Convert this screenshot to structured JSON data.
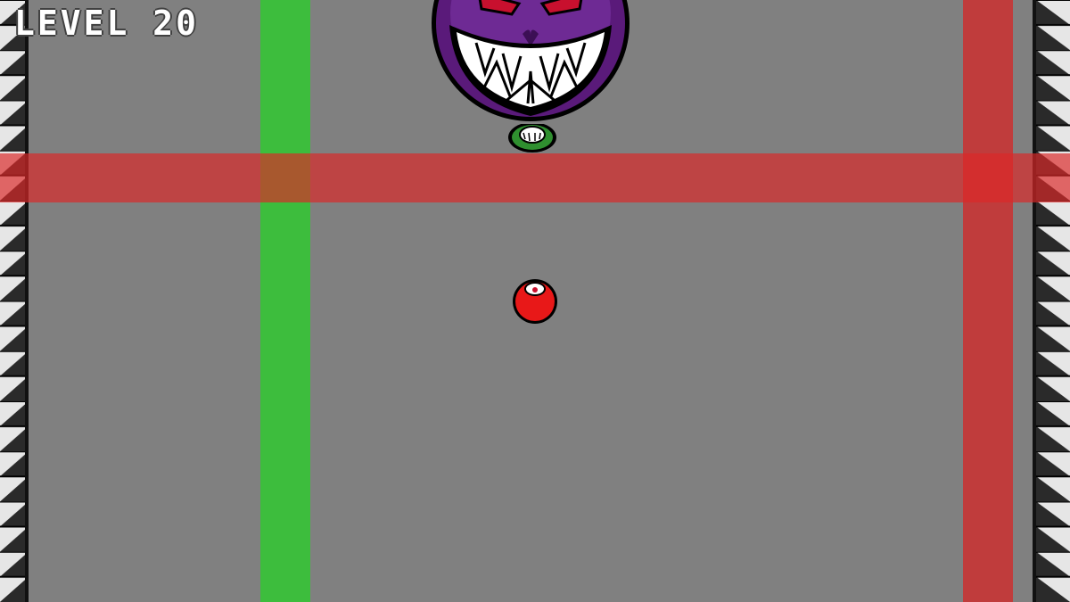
{
  "hud": {
    "level_label": "LEVEL 20"
  },
  "colors": {
    "background": "#808080",
    "green_beam": "#3dbd3d",
    "red_beam": "#c03c3c",
    "boss_purple": "#5a1a7a",
    "player_red": "#e81818"
  },
  "entities": {
    "boss": "grinning-purple-orb-boss",
    "minion": "small-green-orb",
    "player": "red-ball"
  }
}
